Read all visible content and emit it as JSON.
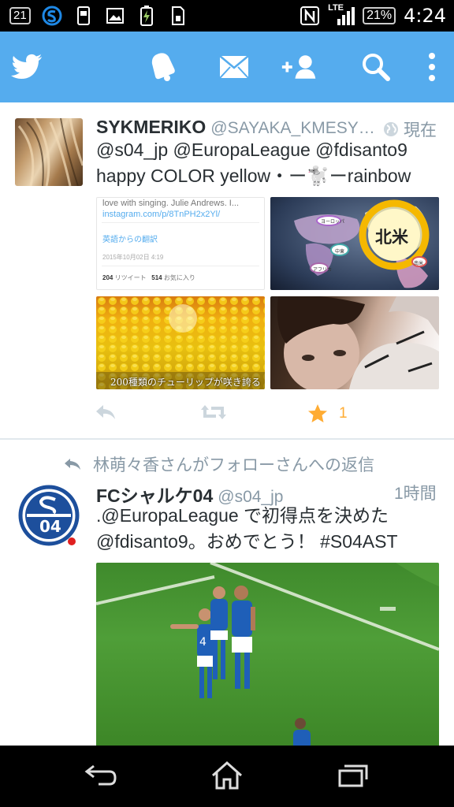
{
  "status_bar": {
    "left_badge": "21",
    "network": "LTE",
    "battery_percent": "21%",
    "time": "4:24",
    "icons": [
      "notification-count-icon",
      "s-app-icon",
      "phone-storage-icon",
      "image-icon",
      "battery-charging-icon",
      "sim-icon",
      "nfc-icon",
      "signal-icon",
      "battery-icon"
    ]
  },
  "header": {
    "icons": [
      "twitter-bird-icon",
      "bell-icon",
      "mail-icon",
      "add-user-icon",
      "search-icon",
      "overflow-menu-icon"
    ],
    "brand_color": "#55acee"
  },
  "tweets": [
    {
      "name": "SYKMERIKO",
      "handle": "@SAYAKA_KMESY…",
      "time": "現在",
      "text_line1": "@s04_jp @EuropaLeague @fdisanto9",
      "text_line2": "happy COLOR yellow・ー🐩ーrainbow",
      "card": {
        "line1": "love with singing. Julie Andrews. I...",
        "link": "instagram.com/p/8TnPH2x2Yl/",
        "translate": "英語からの翻訳",
        "date": "2015年10月02日 4:19",
        "retweets": "204",
        "retweets_label": "リツイート",
        "favorites": "514",
        "favorites_label": "お気に入り"
      },
      "map_label": "北米",
      "map_small_labels": [
        "ヨーロッパ",
        "中東",
        "アフリカ",
        "南米"
      ],
      "tulip_caption": "200種類のチューリップが咲き誇る",
      "favorite_count": "1"
    },
    {
      "context": "林萌々香さんがフォローさんへの返信",
      "name": "FCシャルケ04",
      "handle": "@s04_jp",
      "time": "1時間",
      "text_line1": ".@EuropaLeague で初得点を決めた",
      "text_line2": "@fdisanto9。おめでとう！ #S04AST",
      "logo_text": "04"
    }
  ],
  "nav_bar": {
    "icons": [
      "back-icon",
      "home-icon",
      "recent-apps-icon"
    ]
  }
}
